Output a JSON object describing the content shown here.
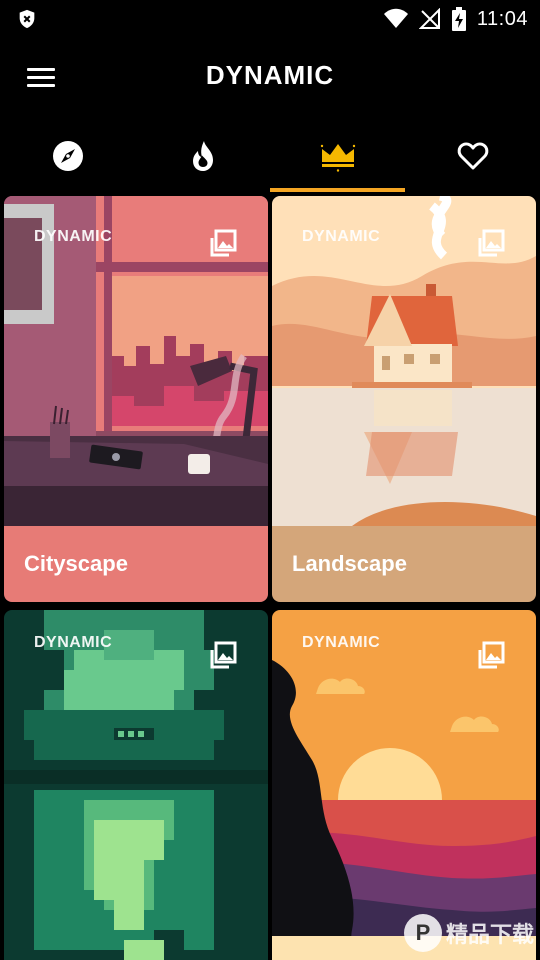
{
  "status_bar": {
    "time": "11:04",
    "icons": [
      "shield-icon",
      "wifi-icon",
      "no-signal-icon",
      "battery-charging-icon"
    ]
  },
  "app_bar": {
    "title": "DYNAMIC",
    "menu_icon": "menu-icon"
  },
  "tabs": [
    {
      "icon": "compass-icon",
      "active": false
    },
    {
      "icon": "fire-icon",
      "active": false
    },
    {
      "icon": "crown-icon",
      "active": true
    },
    {
      "icon": "heart-icon",
      "active": false
    }
  ],
  "accent_color": "#f5a623",
  "cards": [
    {
      "badge": "DYNAMIC",
      "title": "Cityscape",
      "footer_color": "#e77b76",
      "icon": "gallery-icon"
    },
    {
      "badge": "DYNAMIC",
      "title": "Landscape",
      "footer_color": "#d4a67a",
      "icon": "gallery-icon"
    },
    {
      "badge": "DYNAMIC",
      "title": "",
      "footer_color": "#0c5a46",
      "icon": "gallery-icon"
    },
    {
      "badge": "DYNAMIC",
      "title": "",
      "footer_color": "#f4a140",
      "icon": "gallery-icon"
    }
  ],
  "watermark": {
    "text": "精品下载"
  }
}
